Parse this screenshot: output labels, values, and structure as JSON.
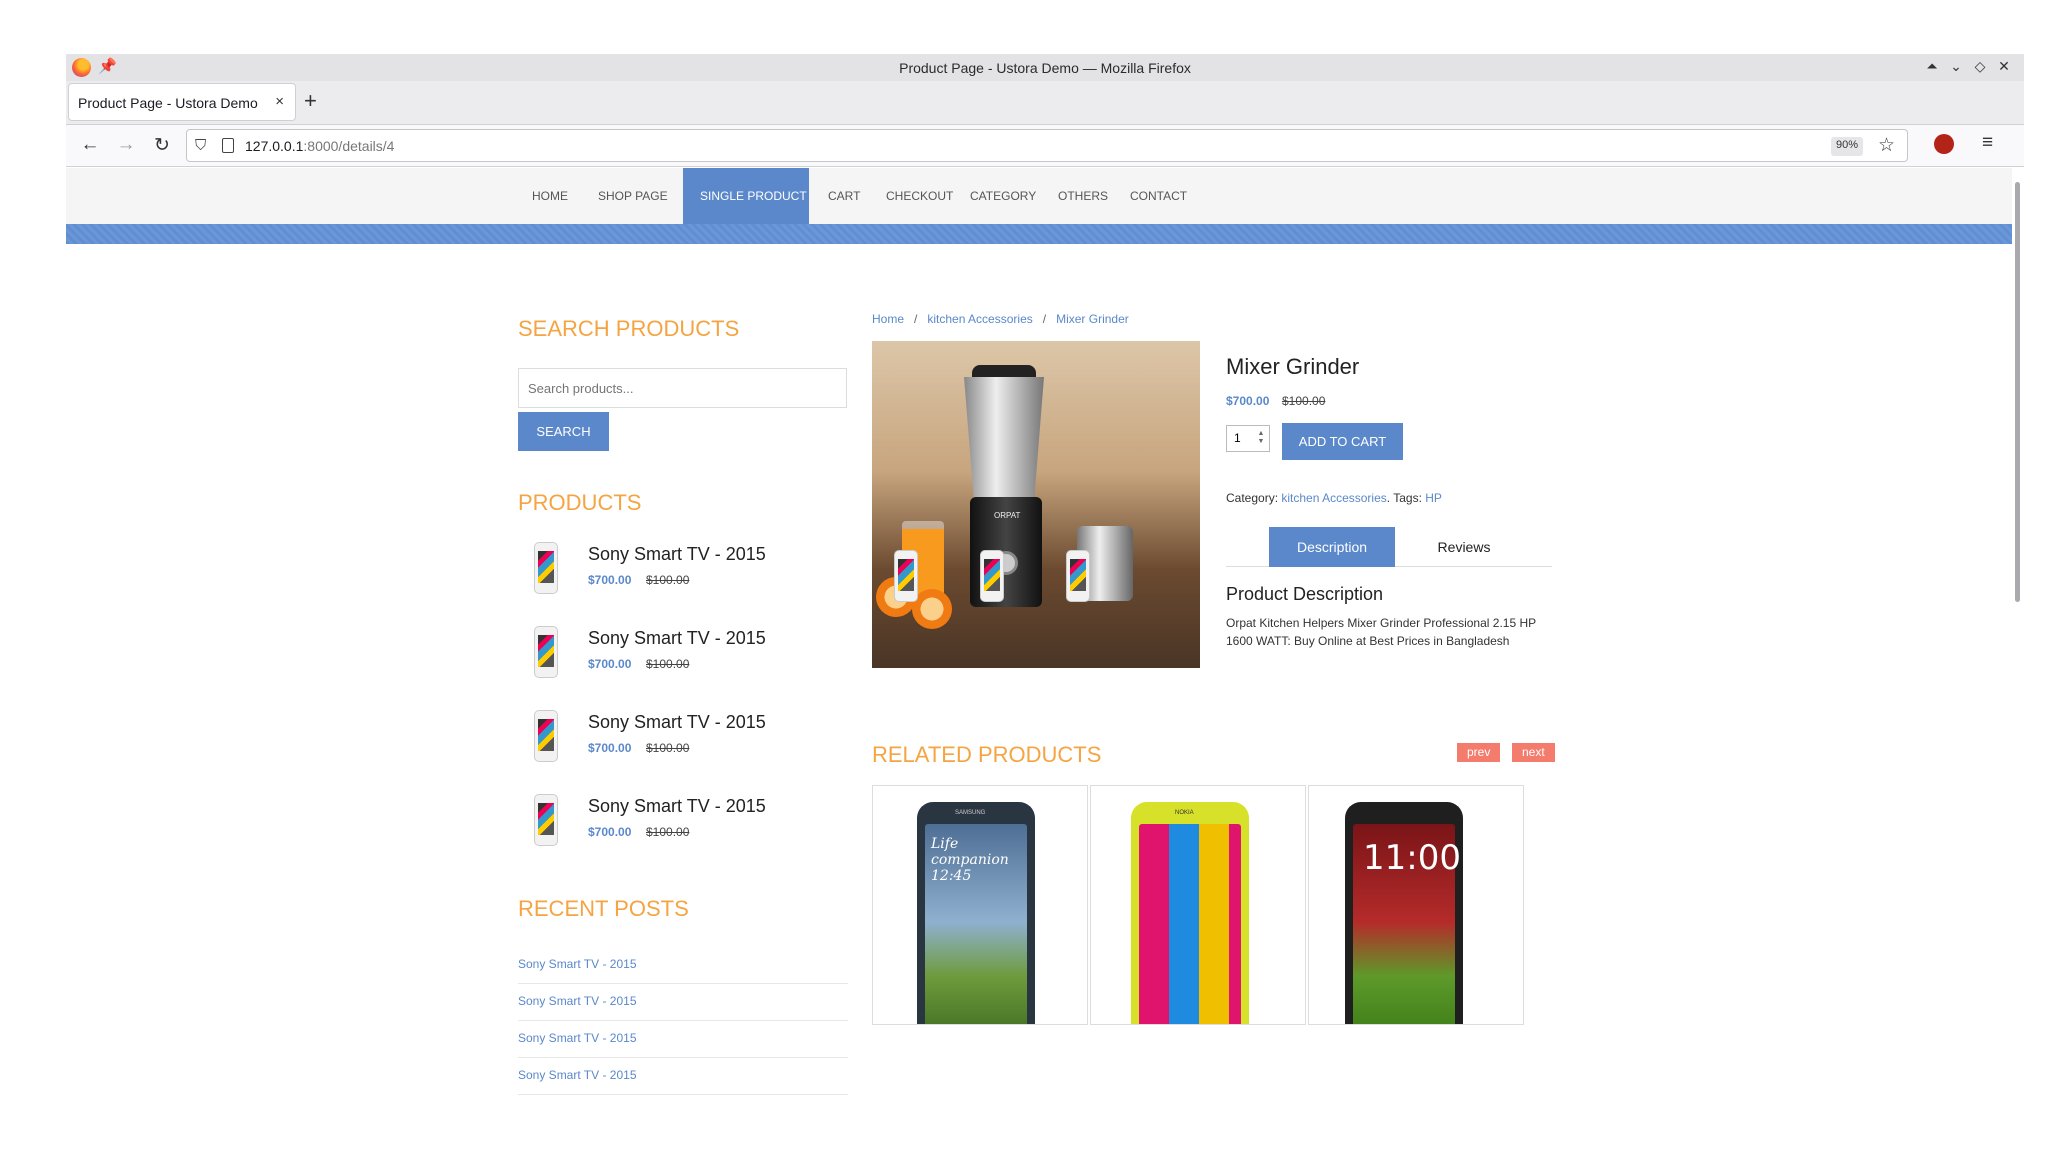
{
  "window": {
    "title": "Product Page - Ustora Demo — Mozilla Firefox",
    "controls": [
      "⏶",
      "⌄",
      "◇",
      "✕"
    ]
  },
  "browser": {
    "tab_title": "Product Page - Ustora Demo",
    "tab_close": "×",
    "new_tab": "+",
    "url_host": "127.0.0.1",
    "url_rest": ":8000/details/4",
    "zoom": "90%"
  },
  "site_nav": {
    "items": [
      "HOME",
      "SHOP PAGE",
      "SINGLE PRODUCT",
      "CART",
      "CHECKOUT",
      "CATEGORY",
      "OTHERS",
      "CONTACT"
    ],
    "active_index": 2
  },
  "sidebar": {
    "search_heading": "SEARCH PRODUCTS",
    "search_placeholder": "Search products...",
    "search_button": "SEARCH",
    "products_heading": "PRODUCTS",
    "products": [
      {
        "name": "Sony Smart TV - 2015",
        "price": "$700.00",
        "old_price": "$100.00"
      },
      {
        "name": "Sony Smart TV - 2015",
        "price": "$700.00",
        "old_price": "$100.00"
      },
      {
        "name": "Sony Smart TV - 2015",
        "price": "$700.00",
        "old_price": "$100.00"
      },
      {
        "name": "Sony Smart TV - 2015",
        "price": "$700.00",
        "old_price": "$100.00"
      }
    ],
    "recent_heading": "RECENT POSTS",
    "recent_posts": [
      "Sony Smart TV - 2015",
      "Sony Smart TV - 2015",
      "Sony Smart TV - 2015",
      "Sony Smart TV - 2015"
    ]
  },
  "breadcrumb": [
    "Home",
    "kitchen Accessories",
    "Mixer Grinder"
  ],
  "product": {
    "title": "Mixer Grinder",
    "price": "$700.00",
    "old_price": "$100.00",
    "quantity": "1",
    "add_to_cart": "ADD TO CART",
    "category_label": "Category:",
    "category": "kitchen Accessories",
    "tags_label": ". Tags:",
    "tag": "HP",
    "image_brand": "ORPAT",
    "tabs": [
      "Description",
      "Reviews"
    ],
    "description_heading": "Product Description",
    "description": "Orpat Kitchen Helpers Mixer Grinder Professional 2.15 HP 1600 WATT: Buy Online at Best Prices in Bangladesh"
  },
  "related": {
    "heading": "RELATED PRODUCTS",
    "prev": "prev",
    "next": "next",
    "items": [
      {
        "screen_text": "Life companion 12:45",
        "brand": "SAMSUNG"
      },
      {
        "screen_text": "",
        "brand": "NOKIA"
      },
      {
        "screen_text": "11:00",
        "brand": ""
      }
    ]
  },
  "colors": {
    "accent": "#5a88ca",
    "heading_orange": "#f5a442",
    "sale_button": "#f47c6d"
  }
}
